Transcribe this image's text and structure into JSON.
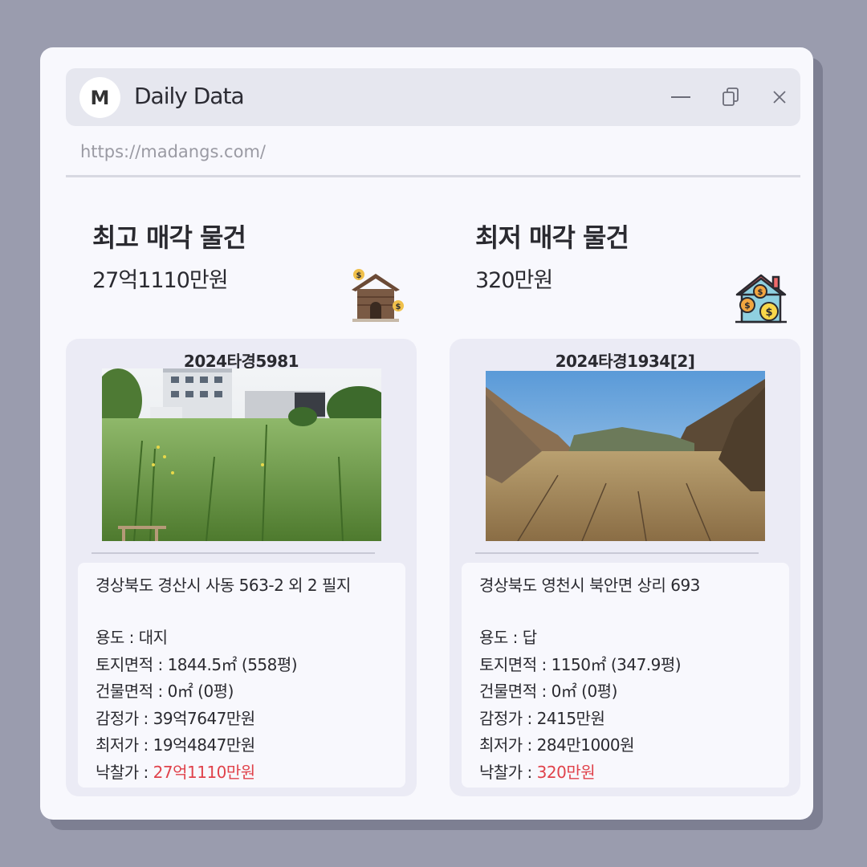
{
  "app": {
    "logo_letter": "M",
    "title": "Daily Data",
    "url": "https://madangs.com/"
  },
  "highest": {
    "heading": "최고 매각 물건",
    "price": "27억1110만원",
    "case_no": "2024타경5981",
    "address": "경상북도 경산시 사동 563-2 외 2 필지",
    "rows": [
      {
        "label": "용도 : ",
        "value": "대지"
      },
      {
        "label": "토지면적 : ",
        "value": "1844.5㎡ (558평)"
      },
      {
        "label": "건물면적 : ",
        "value": "0㎡ (0평)"
      },
      {
        "label": "감정가 : ",
        "value": "39억7647만원"
      },
      {
        "label": "최저가 : ",
        "value": "19억4847만원"
      },
      {
        "label": "낙찰가 : ",
        "value": "27억1110만원"
      }
    ]
  },
  "lowest": {
    "heading": "최저 매각 물건",
    "price": "320만원",
    "case_no": "2024타경1934[2]",
    "address": "경상북도 영천시 북안면 상리 693",
    "rows": [
      {
        "label": "용도 :  ",
        "value": "답"
      },
      {
        "label": "토지면적 : ",
        "value": "1150㎡ (347.9평)"
      },
      {
        "label": "건물면적 : ",
        "value": "0㎡ (0평)"
      },
      {
        "label": "감정가 : ",
        "value": "2415만원"
      },
      {
        "label": "최저가 : ",
        "value": "284만1000원"
      },
      {
        "label": "낙찰가 : ",
        "value": "320만원"
      }
    ]
  },
  "colors": {
    "accent_red": "#e0424b",
    "background": "#9a9cae",
    "window": "#f8f8fd",
    "card": "#ebebf5"
  },
  "icons": [
    "minimize-icon",
    "restore-icon",
    "close-icon",
    "house-money-icon",
    "house-coins-icon"
  ]
}
